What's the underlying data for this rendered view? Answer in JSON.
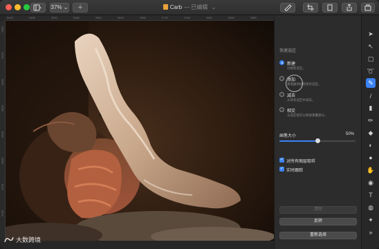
{
  "window": {
    "title": "Carb",
    "subtitle": "— 已编辑",
    "zoom": "37%"
  },
  "rulers": {
    "top": [
      "0440",
      "0480",
      "0520",
      "0560",
      "0600",
      "0640",
      "0680",
      "0720",
      "0760",
      "0800",
      "0840",
      "0880"
    ],
    "left": [
      "0480",
      "0520",
      "0560",
      "0600",
      "0640",
      "0680",
      "0720",
      "0760"
    ]
  },
  "panel": {
    "header": "快速选区",
    "options": [
      {
        "label": "新建",
        "desc": "创建新选区。",
        "selected": true
      },
      {
        "label": "添加",
        "desc": "将笔触添加到现有选区。",
        "selected": false
      },
      {
        "label": "减去",
        "desc": "从现有选区中减去。",
        "selected": false
      },
      {
        "label": "相交",
        "desc": "与选区相交以保留重叠部分。",
        "selected": false
      }
    ],
    "brush_size_label": "画笔大小",
    "brush_size_value": "50%",
    "brush_size": 0.5,
    "checkboxes": [
      {
        "label": "对所有图层取样",
        "checked": true
      },
      {
        "label": "实时跟踪",
        "checked": true
      }
    ],
    "buttons": {
      "clear": "清除",
      "invert": "反转",
      "reset": "重新选择"
    }
  },
  "watermark": "大数跨境",
  "colors": {
    "accent": "#3b82f6",
    "traffic_red": "#ff5f57",
    "traffic_yellow": "#febc2e",
    "traffic_green": "#28c840"
  },
  "tools": [
    "navigate-icon",
    "arrow-icon",
    "rect-select-icon",
    "lasso-icon",
    "quick-select-icon",
    "paintbrush-icon",
    "bucket-icon",
    "pencil-icon",
    "eraser-icon",
    "clone-icon",
    "sponge-icon",
    "smudge-icon",
    "circle-icon",
    "type-icon",
    "color-icon",
    "sparkle-icon",
    "more-icon"
  ]
}
